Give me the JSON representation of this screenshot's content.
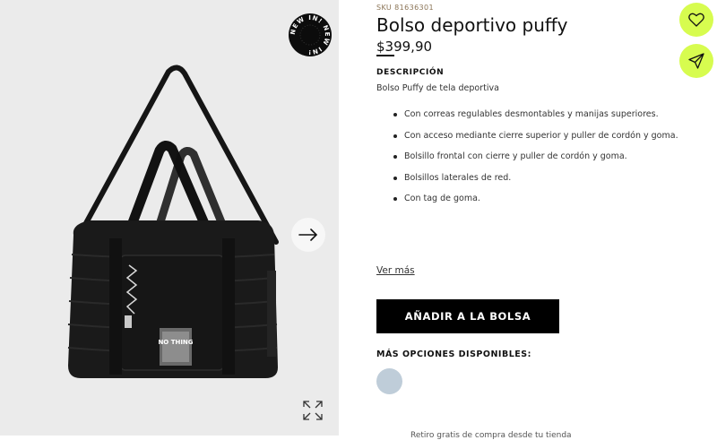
{
  "gallery": {
    "badge_text": "NEW IN! NEW IN!",
    "bag_tag_text": "NO THING",
    "icons": {
      "next": "arrow-right-icon",
      "zoom": "expand-icon"
    }
  },
  "product": {
    "sku": "SKU 81636301",
    "title": "Bolso deportivo puffy",
    "price": "$399,90",
    "description_heading": "DESCRIPCIÓN",
    "description": "Bolso Puffy de tela deportiva",
    "features": [
      "Con correas regulables desmontables y manijas superiores.",
      "Con acceso mediante cierre superior y puller de cordón y goma.",
      "Bolsillo frontal con cierre y puller de cordón y goma.",
      "Bolsillos laterales de red.",
      "Con tag de goma."
    ],
    "see_more": "Ver más",
    "add_to_bag": "AÑADIR A LA BOLSA",
    "more_options_heading": "MÁS OPCIONES DISPONIBLES:",
    "swatch_color": "#bfcdd9",
    "cutoff_text": "Retiro gratis de compra desde tu tienda"
  },
  "actions": {
    "accent_color": "#d7fc4f",
    "wishlist_icon": "heart-icon",
    "share_icon": "paper-plane-icon"
  }
}
